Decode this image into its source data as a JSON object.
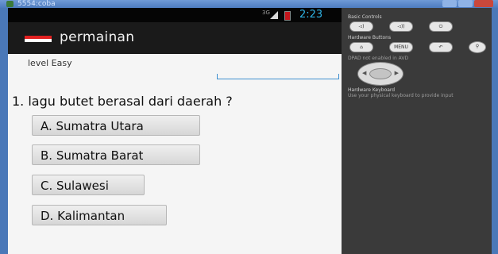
{
  "window": {
    "title": "5554:coba"
  },
  "statusbar": {
    "network": "3G",
    "time": "2:23"
  },
  "actionbar": {
    "title": "permainan"
  },
  "game": {
    "level": "level Easy",
    "question": "1. lagu butet berasal dari daerah ?",
    "answers": [
      {
        "label": "A. Sumatra Utara"
      },
      {
        "label": "B. Sumatra Barat"
      },
      {
        "label": "C. Sulawesi"
      },
      {
        "label": "D. Kalimantan"
      }
    ]
  },
  "panel": {
    "basic_controls": "Basic Controls",
    "hardware_buttons": "Hardware Buttons",
    "menu_label": "MENU",
    "dpad_note": "DPAD not enabled in AVD",
    "keyboard_title": "Hardware Keyboard",
    "keyboard_note": "Use your physical keyboard to provide input"
  },
  "icons": {
    "volume_down": "volume-down-icon",
    "volume_up": "volume-up-icon",
    "power": "power-icon",
    "home": "home-icon",
    "back": "back-icon",
    "search": "search-icon"
  }
}
